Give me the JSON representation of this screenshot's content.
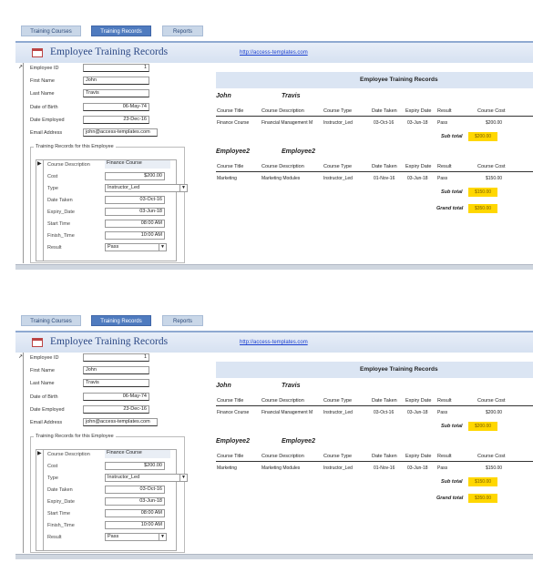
{
  "tabs": [
    "Training Courses",
    "Training Records",
    "Reports"
  ],
  "app_title": "Employee Training Records",
  "link": "http://access-templates.com",
  "form": {
    "labels": [
      "Employee ID",
      "First Name",
      "Last Name",
      "Date of Birth",
      "Date Employed",
      "Email Address"
    ],
    "employee_id": "1",
    "first_name": "John",
    "last_name": "Travis",
    "date_of_birth": "06-May-74",
    "date_employed": "23-Dec-16",
    "email": "john@access-templates.com"
  },
  "sub": {
    "legend": "Training Records for this Employee",
    "labels": [
      "Course Description",
      "Cost",
      "Type",
      "Date Taken",
      "Expiry_Date",
      "Start Time",
      "Finish_Time",
      "Result"
    ],
    "course_description": "Finance Course",
    "cost": "$200.00",
    "type": "Instructor_Led",
    "date_taken": "03-Oct-16",
    "expiry_date": "03-Jun-18",
    "start_time": "08:00 AM",
    "finish_time": "10:00 AM",
    "result": "Pass"
  },
  "report": {
    "title": "Employee Training Records",
    "columns": [
      "Course Title",
      "Course Description",
      "Course Type",
      "Date Taken",
      "Expiry Date",
      "Result",
      "Course Cost"
    ],
    "groups": [
      {
        "first": "John",
        "last": "Travis",
        "rows": [
          [
            "Finance Course",
            "Financial Management M",
            "Instructor_Led",
            "03-Oct-16",
            "03-Jun-18",
            "Pass",
            "$200.00"
          ]
        ],
        "subtotal_label": "Sub total",
        "subtotal": "$200.00"
      },
      {
        "first": "Employee2",
        "last": "Employee2",
        "rows": [
          [
            "Marketing",
            "Marketing Modules",
            "Instructor_Led",
            "01-Nov-16",
            "03-Jun-18",
            "Pass",
            "$150.00"
          ]
        ],
        "subtotal_label": "Sub total",
        "subtotal": "$150.00"
      }
    ],
    "grand_total_label": "Grand total",
    "grand_total": "$350.00"
  },
  "icons": {
    "app": "form-icon",
    "selector": "record-selector-arrow-icon",
    "dropdown": "chevron-down-icon"
  }
}
